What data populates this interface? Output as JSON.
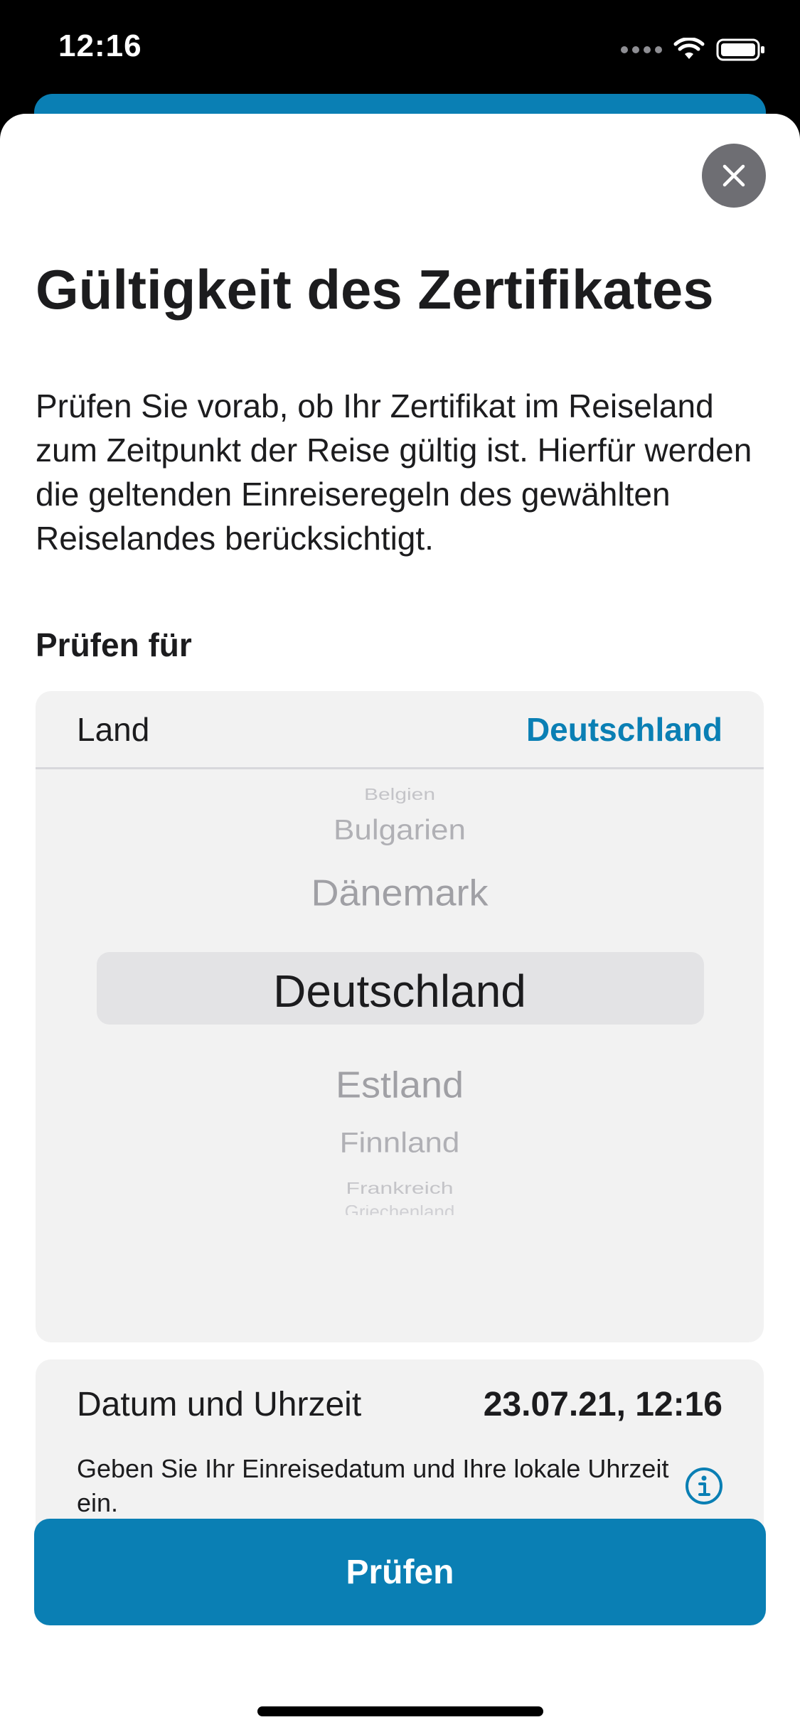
{
  "status_bar": {
    "time": "12:16"
  },
  "sheet": {
    "title": "Gültigkeit des Zertifikates",
    "description": "Prüfen Sie vorab, ob Ihr Zertifikat im Reiseland zum Zeitpunkt der Reise gültig ist. Hierfür werden die geltenden Einreiseregeln des gewählten Reiselandes berücksichtigt.",
    "section_label": "Prüfen für"
  },
  "country": {
    "label": "Land",
    "value": "Deutschland",
    "picker_items": [
      "Belgien",
      "Bulgarien",
      "Dänemark",
      "Deutschland",
      "Estland",
      "Finnland",
      "Frankreich",
      "Griechenland"
    ],
    "selected_index": 3
  },
  "datetime": {
    "label": "Datum und Uhrzeit",
    "value": "23.07.21, 12:16",
    "hint": "Geben Sie Ihr Einreisedatum und Ihre lokale Uhrzeit ein."
  },
  "primary_button": {
    "label": "Prüfen"
  },
  "colors": {
    "accent": "#0a7fb4",
    "card_background": "#f2f2f2",
    "close_button": "#6e6e73"
  },
  "icons": {
    "close": "close-icon",
    "info": "info-icon",
    "wifi": "wifi-icon",
    "battery": "battery-icon",
    "signal": "signal-icon"
  }
}
